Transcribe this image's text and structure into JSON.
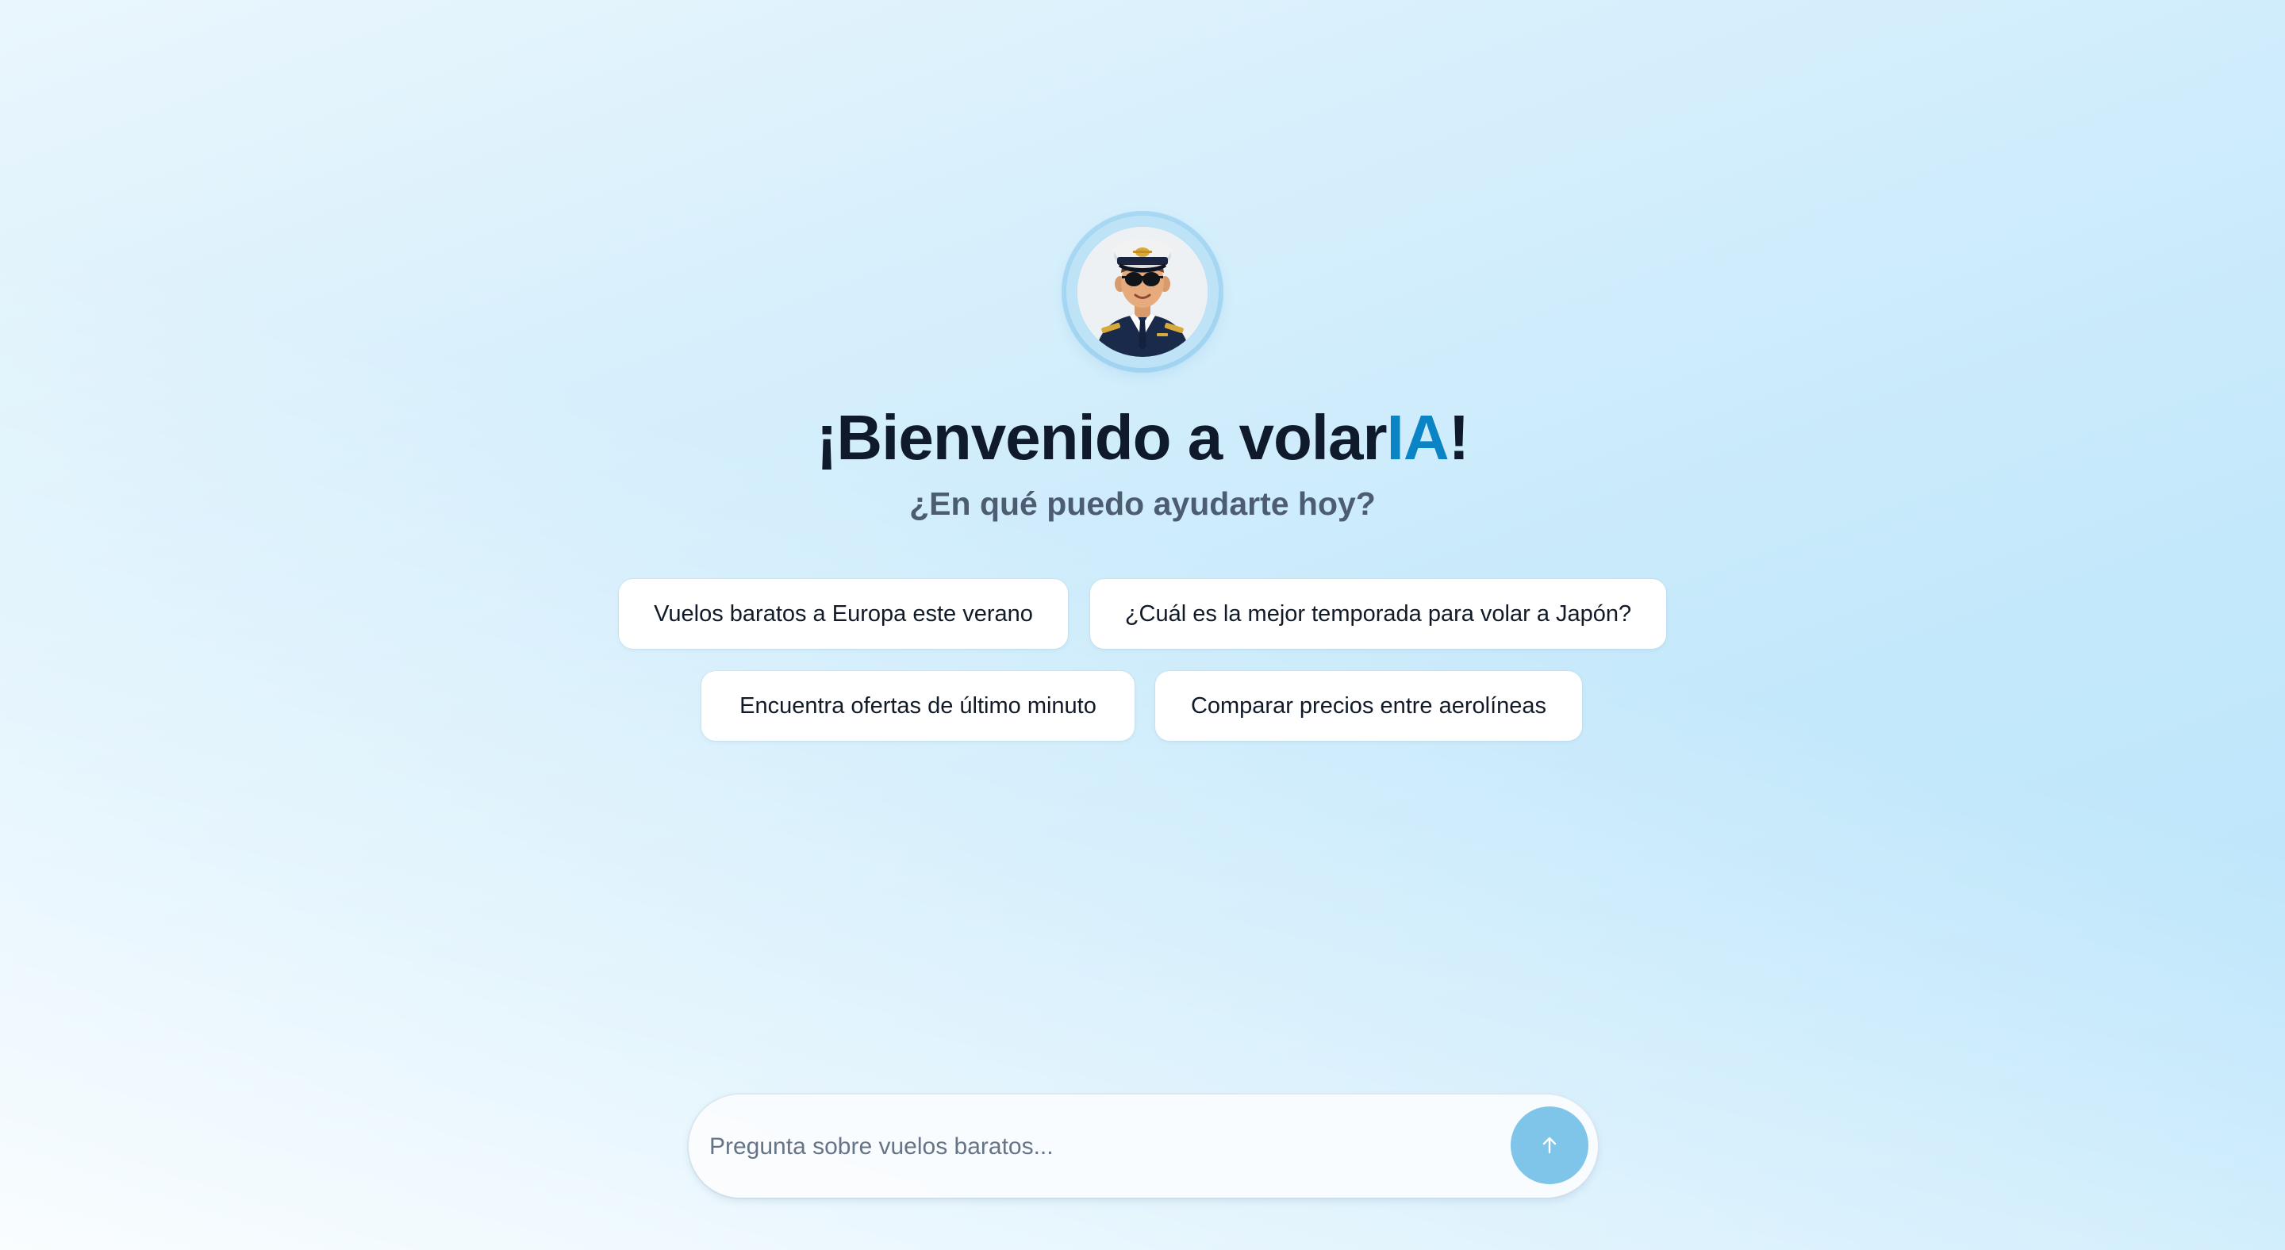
{
  "welcome": {
    "title_prefix": "¡Bienvenido a volar",
    "title_accent": "IA",
    "title_suffix": "!",
    "subtitle": "¿En qué puedo ayudarte hoy?"
  },
  "avatar": {
    "icon": "pilot-avatar-icon"
  },
  "suggestions": [
    {
      "label": "Vuelos baratos a Europa este verano"
    },
    {
      "label": "¿Cuál es la mejor temporada para volar a Japón?"
    },
    {
      "label": "Encuentra ofertas de último minuto"
    },
    {
      "label": "Comparar precios entre aerolíneas"
    }
  ],
  "chat_input": {
    "placeholder": "Pregunta sobre vuelos baratos...",
    "value": "",
    "send_icon": "arrow-up-icon"
  },
  "colors": {
    "accent": "#0b84c6",
    "send_button": "#7fc5e9",
    "title": "#0f1b2d",
    "subtitle": "#4d5d71"
  }
}
